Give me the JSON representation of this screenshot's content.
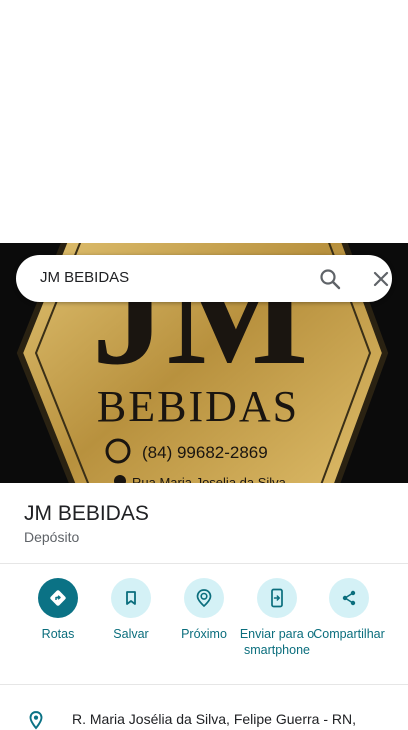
{
  "search": {
    "query": "JM BEBIDAS"
  },
  "hero": {
    "logo_text": "JM",
    "brand_text": "BEBIDAS",
    "phone": "(84) 99682-2869",
    "street_snippet": "Rua Maria Joselia da Silva",
    "accent_color": "#c9a24a"
  },
  "place": {
    "name": "JM BEBIDAS",
    "category": "Depósito"
  },
  "actions": [
    {
      "label": "Rotas",
      "icon": "directions-icon"
    },
    {
      "label": "Salvar",
      "icon": "bookmark-icon"
    },
    {
      "label": "Próximo",
      "icon": "nearby-icon"
    },
    {
      "label": "Enviar para o smartphone",
      "icon": "send-to-phone-icon"
    },
    {
      "label": "Compartilhar",
      "icon": "share-icon"
    }
  ],
  "address": {
    "text": "R. Maria Josélia da Silva, Felipe Guerra - RN,"
  },
  "colors": {
    "primary": "#0b7285",
    "action_bg": "#d4f1f6",
    "action_text": "#0b6e7d"
  }
}
